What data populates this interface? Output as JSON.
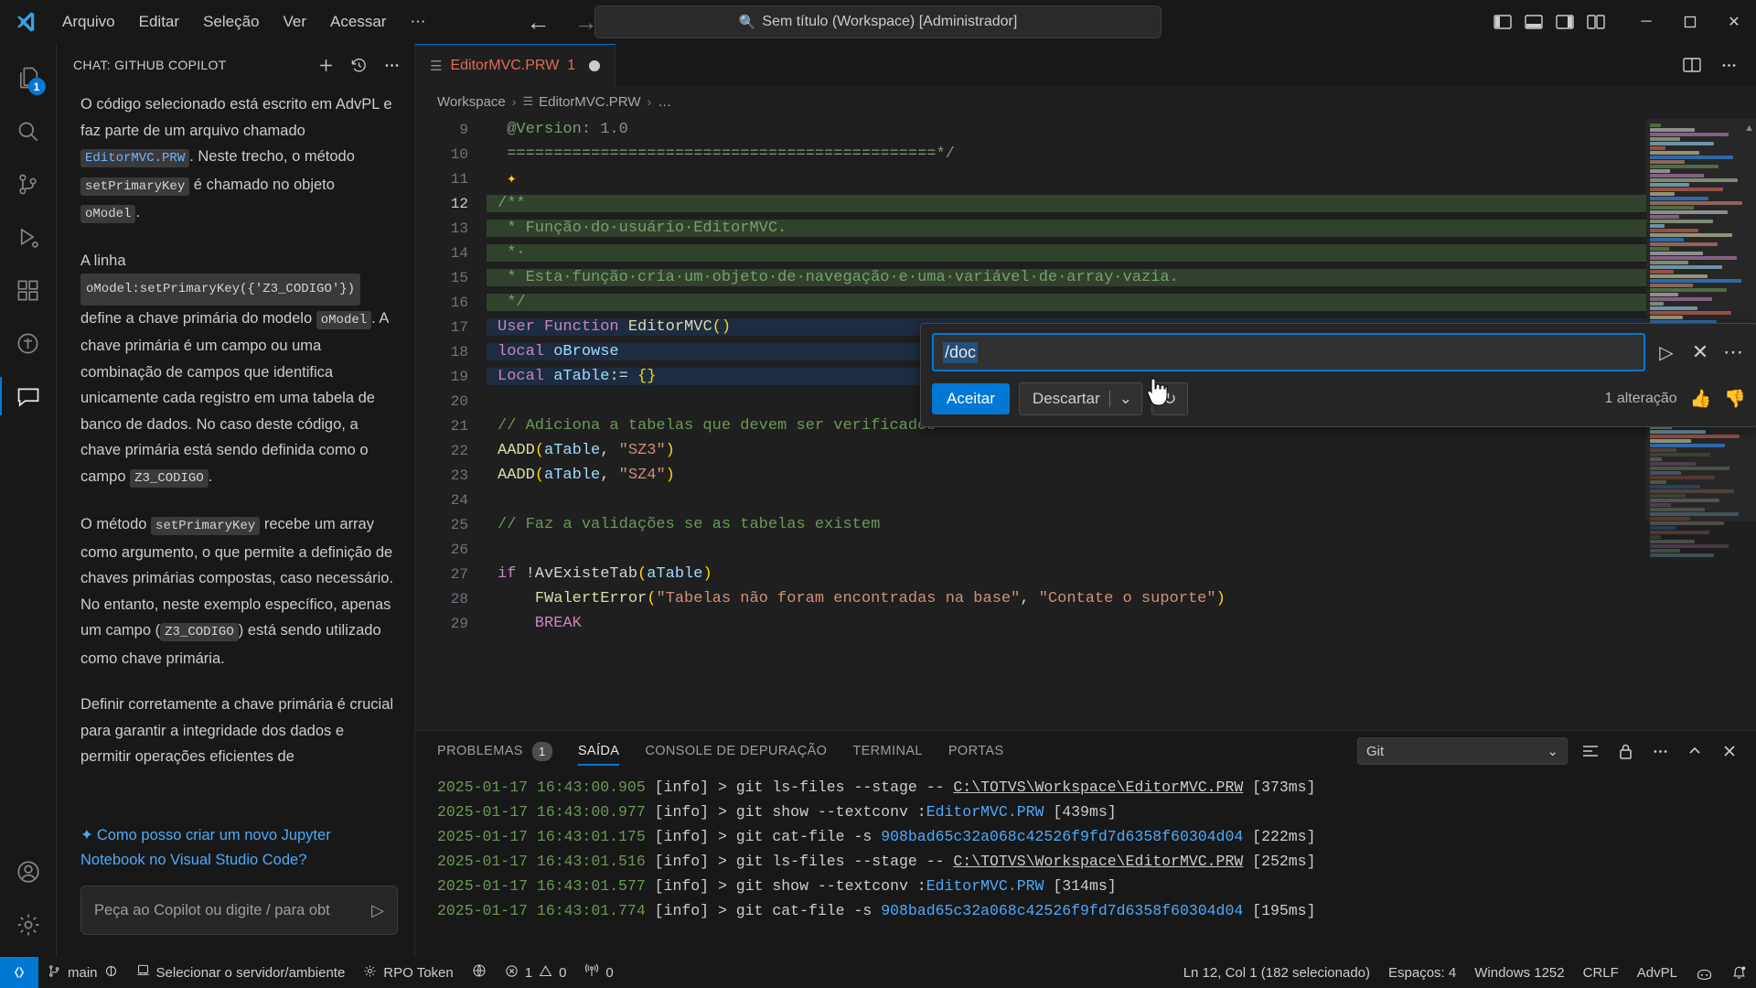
{
  "titlebar": {
    "logo_icon": "vscode-logo-icon",
    "menu": [
      "Arquivo",
      "Editar",
      "Seleção",
      "Ver",
      "Acessar",
      "⋯"
    ],
    "back_icon": "arrow-left-icon",
    "forward_icon": "arrow-right-icon",
    "search_icon": "search-icon",
    "search_text": "Sem título (Workspace) [Administrador]",
    "layout_icons": [
      "panel-left-icon",
      "panel-bottom-icon",
      "panel-right-icon",
      "editor-layout-icon"
    ],
    "minimize": "─",
    "maximize": "❐",
    "close": "✕"
  },
  "activitybar": {
    "items": [
      {
        "name": "explorer",
        "icon": "files-icon",
        "badge": "1",
        "active": false
      },
      {
        "name": "search",
        "icon": "search-icon",
        "badge": "",
        "active": false
      },
      {
        "name": "source-control",
        "icon": "source-control-icon",
        "badge": "",
        "active": false
      },
      {
        "name": "run-debug",
        "icon": "run-debug-icon",
        "badge": "",
        "active": false
      },
      {
        "name": "extensions",
        "icon": "extensions-icon",
        "badge": "",
        "active": false
      },
      {
        "name": "totvs",
        "icon": "totvs-icon",
        "badge": "",
        "active": false
      },
      {
        "name": "chat",
        "icon": "chat-icon",
        "badge": "",
        "active": true
      }
    ],
    "bottom": [
      {
        "name": "accounts",
        "icon": "account-icon"
      },
      {
        "name": "manage",
        "icon": "gear-icon"
      }
    ]
  },
  "sidebar": {
    "title": "CHAT: GITHUB COPILOT",
    "actions": [
      {
        "name": "new-chat",
        "icon": "plus-icon"
      },
      {
        "name": "chat-history",
        "icon": "history-icon"
      },
      {
        "name": "more-actions",
        "icon": "ellipsis-icon"
      }
    ],
    "paragraphs": [
      {
        "parts": [
          {
            "t": "text",
            "v": "O código selecionado está escrito em AdvPL e faz parte de um arquivo chamado "
          },
          {
            "t": "code-blue",
            "v": "EditorMVC.PRW"
          },
          {
            "t": "text",
            "v": ". Neste trecho, o método "
          },
          {
            "t": "code",
            "v": "setPrimaryKey"
          },
          {
            "t": "text",
            "v": " é chamado no objeto "
          },
          {
            "t": "code",
            "v": "oModel"
          },
          {
            "t": "text",
            "v": "."
          }
        ]
      },
      {
        "parts": [
          {
            "t": "text",
            "v": "A linha "
          },
          {
            "t": "code-block",
            "v": "oModel:setPrimaryKey({'Z3_CODIGO'})"
          },
          {
            "t": "text",
            "v": " define a chave primária do modelo "
          },
          {
            "t": "code",
            "v": "oModel"
          },
          {
            "t": "text",
            "v": ". A chave primária é um campo ou uma combinação de campos que identifica unicamente cada registro em uma tabela de banco de dados. No caso deste código, a chave primária está sendo definida como o campo "
          },
          {
            "t": "code",
            "v": "Z3_CODIGO"
          },
          {
            "t": "text",
            "v": "."
          }
        ]
      },
      {
        "parts": [
          {
            "t": "text",
            "v": "O método "
          },
          {
            "t": "code",
            "v": "setPrimaryKey"
          },
          {
            "t": "text",
            "v": " recebe um array como argumento, o que permite a definição de chaves primárias compostas, caso necessário. No entanto, neste exemplo específico, apenas um campo ("
          },
          {
            "t": "code",
            "v": "Z3_CODIGO"
          },
          {
            "t": "text",
            "v": ") está sendo utilizado como chave primária."
          }
        ]
      },
      {
        "parts": [
          {
            "t": "text",
            "v": "Definir corretamente a chave primária é crucial para garantir a integridade dos dados e permitir operações eficientes de"
          }
        ]
      }
    ],
    "suggestion": {
      "icon": "sparkle-icon",
      "text": "Como posso criar um novo Jupyter Notebook no Visual Studio Code?"
    },
    "input": {
      "placeholder": "Peça ao Copilot ou digite / para obt",
      "send_icon": "send-icon"
    }
  },
  "tabs": {
    "items": [
      {
        "label": "EditorMVC.PRW",
        "badge": "1",
        "icon": "advpl-file-icon",
        "dirty": true,
        "active": true
      }
    ],
    "actions": [
      {
        "name": "split-editor",
        "icon": "split-editor-icon"
      },
      {
        "name": "more-actions",
        "icon": "ellipsis-icon"
      }
    ]
  },
  "breadcrumbs": [
    "Workspace",
    "EditorMVC.PRW",
    "…"
  ],
  "editor": {
    "lines": [
      {
        "num": "9",
        "mark": "",
        "hl": "",
        "tokens": [
          {
            "c": "c-doc",
            "v": " @Version: 1.0"
          }
        ]
      },
      {
        "num": "10",
        "mark": "",
        "hl": "",
        "tokens": [
          {
            "c": "c-doc",
            "v": " ==============================================*/"
          }
        ]
      },
      {
        "num": "11",
        "mark": "",
        "hl": "",
        "tokens": [
          {
            "c": "c-yellow",
            "v": " ✦"
          }
        ]
      },
      {
        "num": "12",
        "mark": "add",
        "hl": "ln-green",
        "tokens": [
          {
            "c": "c-doc",
            "v": "/**"
          }
        ]
      },
      {
        "num": "13",
        "mark": "add",
        "hl": "ln-green",
        "tokens": [
          {
            "c": "c-doc",
            "v": " * Função·do·usuário·EditorMVC."
          }
        ]
      },
      {
        "num": "14",
        "mark": "add",
        "hl": "ln-green",
        "tokens": [
          {
            "c": "c-doc",
            "v": " *·"
          }
        ]
      },
      {
        "num": "15",
        "mark": "add",
        "hl": "ln-green",
        "tokens": [
          {
            "c": "c-doc",
            "v": " * Esta·função·cria·um·objeto·de·navegação·e·uma·variável·de·array·vazia."
          }
        ]
      },
      {
        "num": "16",
        "mark": "add",
        "hl": "ln-green",
        "tokens": [
          {
            "c": "c-doc",
            "v": " */"
          }
        ]
      },
      {
        "num": "17",
        "mark": "",
        "hl": "ln-blue",
        "tokens": [
          {
            "c": "c-kw",
            "v": "User Function "
          },
          {
            "c": "c-fn",
            "v": "EditorMVC"
          },
          {
            "c": "c-yellow",
            "v": "()"
          }
        ]
      },
      {
        "num": "18",
        "mark": "",
        "hl": "ln-blue",
        "tokens": [
          {
            "c": "c-kw",
            "v": "local "
          },
          {
            "c": "c-var",
            "v": "oBrowse"
          }
        ]
      },
      {
        "num": "19",
        "mark": "",
        "hl": "ln-blue",
        "tokens": [
          {
            "c": "c-kw",
            "v": "Local "
          },
          {
            "c": "c-var",
            "v": "aTable"
          },
          {
            "c": "c-op",
            "v": ":= "
          },
          {
            "c": "c-yellow",
            "v": "{}"
          }
        ]
      },
      {
        "num": "20",
        "mark": "",
        "hl": "",
        "tokens": [
          {
            "c": "c-plain",
            "v": ""
          }
        ]
      },
      {
        "num": "21",
        "mark": "",
        "hl": "",
        "tokens": [
          {
            "c": "c-comment",
            "v": "// Adiciona a tabelas que devem ser verificados"
          }
        ]
      },
      {
        "num": "22",
        "mark": "",
        "hl": "",
        "tokens": [
          {
            "c": "c-fn",
            "v": "AADD"
          },
          {
            "c": "c-yellow",
            "v": "("
          },
          {
            "c": "c-var",
            "v": "aTable"
          },
          {
            "c": "c-plain",
            "v": ", "
          },
          {
            "c": "c-str",
            "v": "\"SZ3\""
          },
          {
            "c": "c-yellow",
            "v": ")"
          }
        ]
      },
      {
        "num": "23",
        "mark": "blue",
        "hl": "",
        "tokens": [
          {
            "c": "c-fn",
            "v": "AADD"
          },
          {
            "c": "c-yellow",
            "v": "("
          },
          {
            "c": "c-var",
            "v": "aTable"
          },
          {
            "c": "c-plain",
            "v": ", "
          },
          {
            "c": "c-str",
            "v": "\"SZ4\""
          },
          {
            "c": "c-yellow",
            "v": ")"
          }
        ]
      },
      {
        "num": "24",
        "mark": "",
        "hl": "",
        "tokens": [
          {
            "c": "c-plain",
            "v": ""
          }
        ]
      },
      {
        "num": "25",
        "mark": "",
        "hl": "",
        "tokens": [
          {
            "c": "c-comment",
            "v": "// Faz a validações se as tabelas existem"
          }
        ]
      },
      {
        "num": "26",
        "mark": "",
        "hl": "",
        "tokens": [
          {
            "c": "c-plain",
            "v": ""
          }
        ]
      },
      {
        "num": "27",
        "mark": "",
        "hl": "",
        "tokens": [
          {
            "c": "c-kw",
            "v": "if "
          },
          {
            "c": "c-plain",
            "v": "!AvExisteTab"
          },
          {
            "c": "c-yellow",
            "v": "("
          },
          {
            "c": "c-var",
            "v": "aTable"
          },
          {
            "c": "c-yellow",
            "v": ")"
          }
        ]
      },
      {
        "num": "28",
        "mark": "",
        "hl": "",
        "tokens": [
          {
            "c": "c-plain",
            "v": "    "
          },
          {
            "c": "c-fn",
            "v": "FWalertError"
          },
          {
            "c": "c-yellow",
            "v": "("
          },
          {
            "c": "c-str",
            "v": "\"Tabelas não foram encontradas na base\""
          },
          {
            "c": "c-plain",
            "v": ", "
          },
          {
            "c": "c-str",
            "v": "\"Contate o suporte\""
          },
          {
            "c": "c-yellow",
            "v": ")"
          }
        ]
      },
      {
        "num": "29",
        "mark": "",
        "hl": "",
        "tokens": [
          {
            "c": "c-kw",
            "v": "    BREAK"
          }
        ]
      }
    ]
  },
  "inline_chat": {
    "input_value": "/doc",
    "send_icon": "send-icon",
    "close_icon": "close-icon",
    "more_icon": "ellipsis-icon",
    "accept_label": "Aceitar",
    "discard_label": "Descartar",
    "discard_chevron": "chevron-down-icon",
    "rerun_icon": "refresh-icon",
    "changes_label": "1 alteração",
    "thumbs_up_icon": "thumbs-up-icon",
    "thumbs_down_icon": "thumbs-down-icon"
  },
  "panel": {
    "tabs": [
      {
        "label": "PROBLEMAS",
        "badge": "1",
        "active": false
      },
      {
        "label": "SAÍDA",
        "badge": "",
        "active": true
      },
      {
        "label": "CONSOLE DE DEPURAÇÃO",
        "badge": "",
        "active": false
      },
      {
        "label": "TERMINAL",
        "badge": "",
        "active": false
      },
      {
        "label": "PORTAS",
        "badge": "",
        "active": false
      }
    ],
    "select_value": "Git",
    "select_chevron": "chevron-down-icon",
    "actions": [
      {
        "name": "clear-output",
        "icon": "clear-output-icon"
      },
      {
        "name": "lock-scroll",
        "icon": "lock-icon"
      },
      {
        "name": "more-actions",
        "icon": "ellipsis-icon"
      },
      {
        "name": "maximize-panel",
        "icon": "chevron-up-icon"
      },
      {
        "name": "close-panel",
        "icon": "close-icon"
      }
    ],
    "output_lines": [
      [
        {
          "c": "o-ts",
          "v": "2025-01-17 16:43:00.905 "
        },
        {
          "c": "o-info",
          "v": "[info] > git ls-files --stage -- "
        },
        {
          "c": "o-path",
          "v": "C:\\TOTVS\\Workspace\\EditorMVC.PRW"
        },
        {
          "c": "o-info",
          "v": " [373ms]"
        }
      ],
      [
        {
          "c": "o-ts",
          "v": "2025-01-17 16:43:00.977 "
        },
        {
          "c": "o-info",
          "v": "[info] > git show --textconv :"
        },
        {
          "c": "o-blue",
          "v": "EditorMVC.PRW"
        },
        {
          "c": "o-info",
          "v": " [439ms]"
        }
      ],
      [
        {
          "c": "o-ts",
          "v": "2025-01-17 16:43:01.175 "
        },
        {
          "c": "o-info",
          "v": "[info] > git cat-file -s "
        },
        {
          "c": "o-blue",
          "v": "908bad65c32a068c42526f9fd7d6358f60304d04"
        },
        {
          "c": "o-info",
          "v": " [222ms]"
        }
      ],
      [
        {
          "c": "o-ts",
          "v": "2025-01-17 16:43:01.516 "
        },
        {
          "c": "o-info",
          "v": "[info] > git ls-files --stage -- "
        },
        {
          "c": "o-path",
          "v": "C:\\TOTVS\\Workspace\\EditorMVC.PRW"
        },
        {
          "c": "o-info",
          "v": " [252ms]"
        }
      ],
      [
        {
          "c": "o-ts",
          "v": "2025-01-17 16:43:01.577 "
        },
        {
          "c": "o-info",
          "v": "[info] > git show --textconv :"
        },
        {
          "c": "o-blue",
          "v": "EditorMVC.PRW"
        },
        {
          "c": "o-info",
          "v": " [314ms]"
        }
      ],
      [
        {
          "c": "o-ts",
          "v": "2025-01-17 16:43:01.774 "
        },
        {
          "c": "o-info",
          "v": "[info] > git cat-file -s "
        },
        {
          "c": "o-blue",
          "v": "908bad65c32a068c42526f9fd7d6358f60304d04"
        },
        {
          "c": "o-info",
          "v": " [195ms]"
        }
      ]
    ]
  },
  "statusbar": {
    "remote_icon": "remote-indicator-icon",
    "left": [
      {
        "name": "branch",
        "icon": "branch-icon",
        "label": "main",
        "extra_icon": "sync-icon"
      },
      {
        "name": "server-select",
        "icon": "server-icon",
        "label": "Selecionar o servidor/ambiente",
        "extra_icon": ""
      },
      {
        "name": "rpo-token",
        "icon": "gear-icon",
        "label": "RPO Token",
        "extra_icon": ""
      },
      {
        "name": "globe",
        "icon": "globe-icon",
        "label": "",
        "extra_icon": ""
      },
      {
        "name": "problems",
        "icon": "error-icon",
        "label": "1",
        "extra_icon": "warning-icon",
        "label2": "0"
      },
      {
        "name": "radio-tower",
        "icon": "radio-tower-icon",
        "label": "0",
        "extra_icon": ""
      }
    ],
    "right": [
      {
        "name": "cursor-position",
        "label": "Ln 12, Col 1 (182 selecionado)"
      },
      {
        "name": "indentation",
        "label": "Espaços: 4"
      },
      {
        "name": "encoding",
        "label": "Windows 1252"
      },
      {
        "name": "eol",
        "label": "CRLF"
      },
      {
        "name": "language-mode",
        "label": "AdvPL"
      },
      {
        "name": "copilot-status",
        "label": "",
        "icon": "copilot-icon"
      },
      {
        "name": "notifications",
        "label": "",
        "icon": "bell-dot-icon"
      }
    ]
  },
  "colors": {
    "accent": "#0078d4",
    "tab_error": "#e06c5a",
    "added_line": "#3e5e36",
    "link": "#4daafc"
  }
}
